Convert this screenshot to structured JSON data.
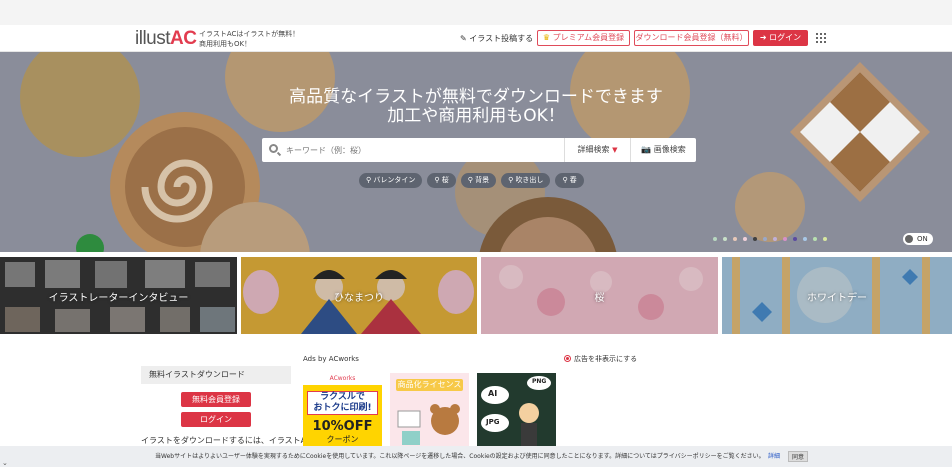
{
  "header": {
    "logo_main": "illust",
    "logo_accent": "AC",
    "tagline_1": "イラストACはイラストが無料！",
    "tagline_2": "商用利用もOK！",
    "post_link": "イラスト投稿する",
    "premium_button": "プレミアム会員登録",
    "download_register_button": "ダウンロード会員登録（無料）",
    "login_button": "ログイン"
  },
  "hero": {
    "title_line1": "高品質なイラストが無料でダウンロードできます",
    "title_line2": "加工や商用利用もOK！",
    "search_placeholder": "キーワード（例：桜）",
    "advanced_search": "詳細検索",
    "image_search": "画像検索",
    "tags": [
      "バレンタイン",
      "桜",
      "背景",
      "吹き出し",
      "春"
    ],
    "toggle_label": "ON",
    "dot_colors": [
      "#b8d8c0",
      "#c8e0c8",
      "#e8c8b8",
      "#f0d0d8",
      "#404040",
      "#9aa8c8",
      "#c0b0d8",
      "#d890c8",
      "#5a4aa0",
      "#a8c8e8",
      "#b8e0b0",
      "#d8e8a0"
    ]
  },
  "categories": [
    "イラストレーターインタビュー",
    "ひなまつり",
    "桜",
    "ホワイトデー"
  ],
  "sidebar": {
    "heading": "無料イラストダウンロード",
    "register_button": "無料会員登録",
    "login_button": "ログイン",
    "note": "イラストをダウンロードするには、イラストAC"
  },
  "ads": {
    "label": "Ads by ACworks",
    "hide_label": "広告を非表示にする",
    "ad1_brand": "ACworks",
    "ad1_line1": "ラクスルで",
    "ad1_line2": "おトクに印刷!",
    "ad1_discount": "10%OFF",
    "ad1_coupon": "クーポン",
    "ad2_title": "商品化ライセンス",
    "ad3_labels": [
      "AI",
      "PNG",
      "JPG"
    ]
  },
  "cookie_bar": {
    "text": "当Webサイトはよりよいユーザー体験を実現するためにCookieを使用しています。これ以降ページを遷移した場合、Cookieの設定および使用に同意したことになります。詳細についてはプライバシーポリシーをご覧ください。",
    "detail_link": "詳細",
    "agree_button": "同意"
  },
  "colors": {
    "brand_red": "#dc3545",
    "hero_overlay": "#8a8d9a"
  }
}
